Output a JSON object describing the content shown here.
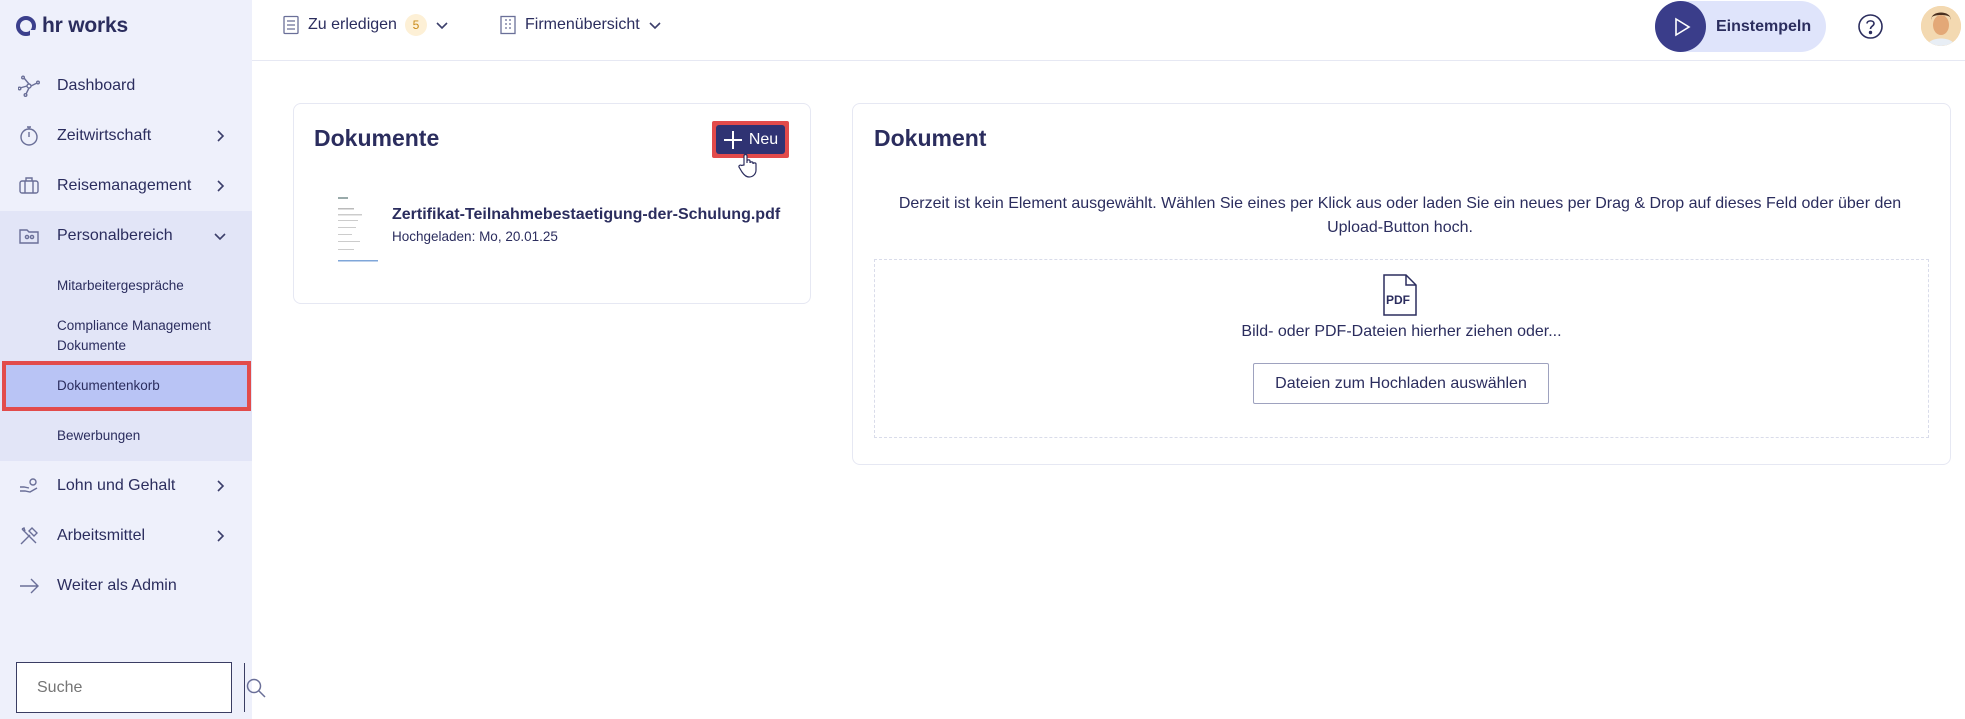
{
  "app": {
    "logo_text": "hr works"
  },
  "sidebar": {
    "items": [
      {
        "label": "Dashboard",
        "icon": "dashboard-icon",
        "chevron": ""
      },
      {
        "label": "Zeitwirtschaft",
        "icon": "stopwatch-icon",
        "chevron": "right"
      },
      {
        "label": "Reisemanagement",
        "icon": "suitcase-icon",
        "chevron": "right"
      },
      {
        "label": "Personalbereich",
        "icon": "folder-people-icon",
        "chevron": "down"
      }
    ],
    "sub_items": [
      {
        "label": "Mitarbeitergespräche"
      },
      {
        "label": "Compliance Management Dokumente"
      },
      {
        "label": "Dokumentenkorb",
        "active": true
      },
      {
        "label": "Bewerbungen"
      }
    ],
    "items_after": [
      {
        "label": "Lohn und Gehalt",
        "icon": "hand-money-icon",
        "chevron": "right"
      },
      {
        "label": "Arbeitsmittel",
        "icon": "tools-icon",
        "chevron": "right"
      },
      {
        "label": "Weiter als Admin",
        "icon": "arrow-right-icon",
        "chevron": ""
      }
    ],
    "search": {
      "placeholder": "Suche"
    }
  },
  "topbar": {
    "todo_label": "Zu erledigen",
    "todo_count": "5",
    "company_label": "Firmenübersicht",
    "stamp_label": "Einstempeln"
  },
  "documents_card": {
    "title": "Dokumente",
    "new_button_label": "Neu",
    "items": [
      {
        "name": "Zertifikat-Teilnahmebestaetigung-der-Schulung.pdf",
        "uploaded": "Hochgeladen: Mo, 20.01.25"
      }
    ]
  },
  "document_card": {
    "title": "Dokument",
    "hint": "Derzeit ist kein Element ausgewählt. Wählen Sie eines per Klick aus oder laden Sie ein neues per Drag & Drop auf dieses Feld oder über den Upload-Button hoch.",
    "pdf_label": "PDF",
    "drop_text": "Bild- oder PDF-Dateien hierher ziehen oder...",
    "upload_button": "Dateien zum Hochladen auswählen"
  },
  "colors": {
    "accent": "#2f3373",
    "highlight": "#e24b4b",
    "sidebar_bg": "#eef0fb",
    "active_bg": "#b9c4f5"
  }
}
